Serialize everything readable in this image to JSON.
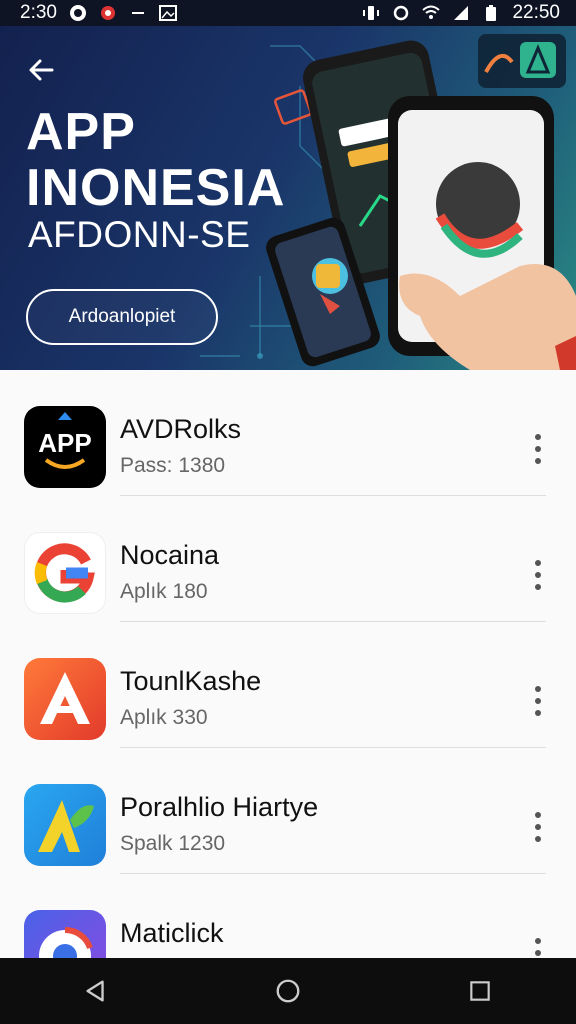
{
  "status_bar": {
    "time_left": "2:30",
    "time_right": "22:50"
  },
  "hero": {
    "title_line1": "APP",
    "title_line2": "INONESIA",
    "subtitle": "AFDONN-SE",
    "button_label": "Ardoanlopiet"
  },
  "apps": [
    {
      "name": "AVDRolks",
      "meta": "Pass: 1380",
      "icon": "app-store-icon",
      "icon_text": "APP"
    },
    {
      "name": "Nocaina",
      "meta": "Aplık 180",
      "icon": "google-g-icon"
    },
    {
      "name": "TounlKashe",
      "meta": "Aplık 330",
      "icon": "a-letter-red-icon"
    },
    {
      "name": "Poralhlio Hiartye",
      "meta": "Spalk 1230",
      "icon": "a-leaf-icon"
    },
    {
      "name": "Maticlick",
      "meta": "",
      "icon": "chrome-like-icon"
    }
  ],
  "colors": {
    "hero_start": "#13214f",
    "hero_end": "#2a8d83",
    "nav_bar": "#0d0d0d",
    "status_bar": "#0e1424"
  }
}
